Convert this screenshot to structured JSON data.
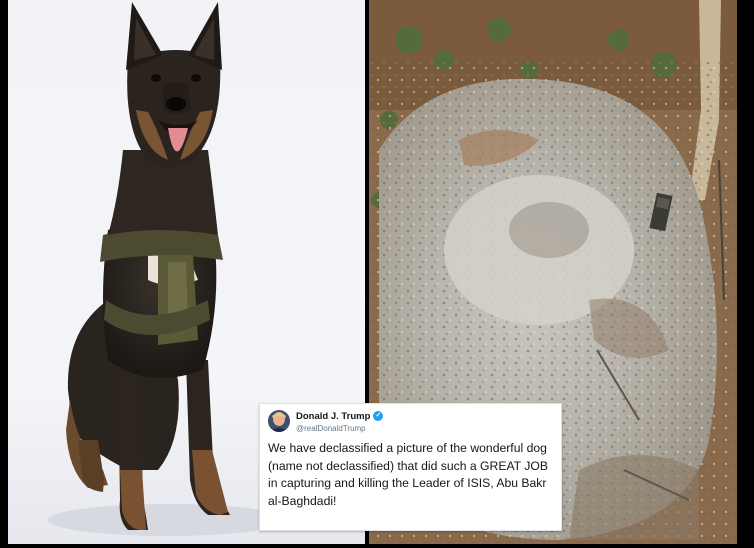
{
  "tweet": {
    "author_name": "Donald J. Trump",
    "handle": "@realDonaldTrump",
    "text": "We have declassified a picture of the wonderful dog (name not declassified) that did such a GREAT JOB in capturing and killing the Leader of ISIS, Abu Bakr al-Baghdadi!"
  },
  "colors": {
    "verified_badge": "#1da1f2",
    "tweet_bg": "#ffffff",
    "backdrop": "#f4f5f8"
  },
  "icons": [
    "verified-badge-icon"
  ]
}
